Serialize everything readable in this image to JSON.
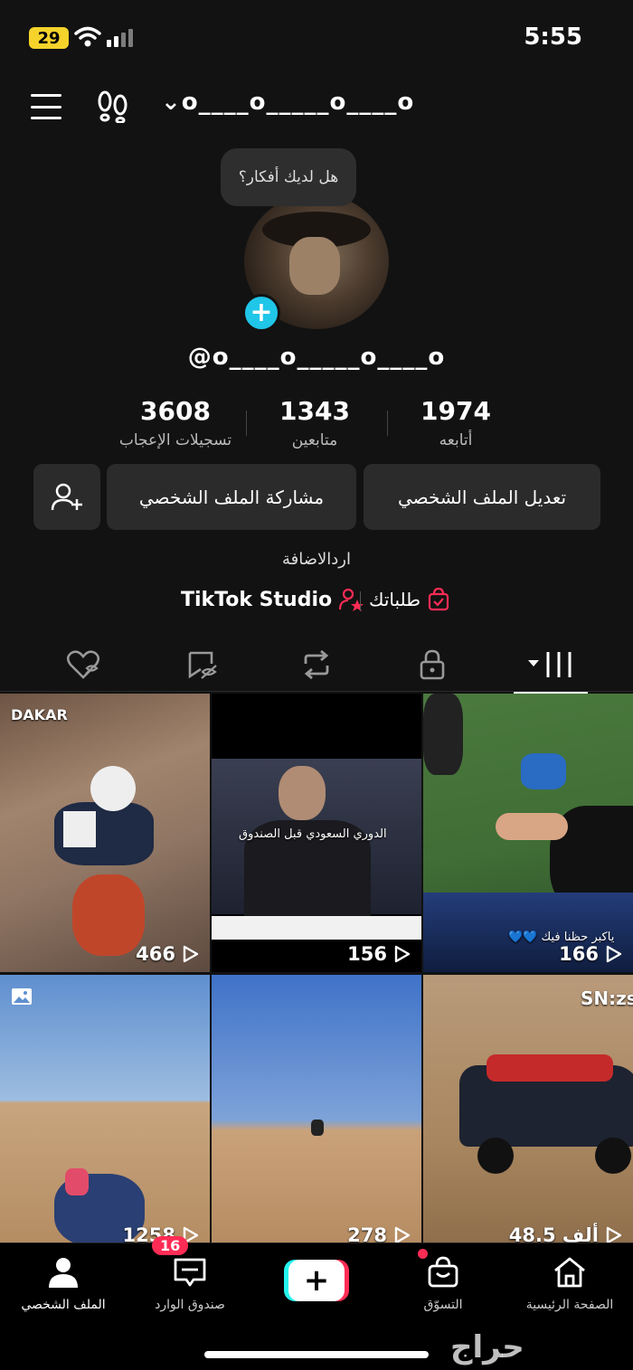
{
  "status_bar": {
    "battery": "29",
    "time": "5:55"
  },
  "header": {
    "username": "o____o_____o____o"
  },
  "profile": {
    "note_bubble": "هل لديك أفكار؟",
    "handle": "@o____o_____o____o",
    "stats": {
      "likes": {
        "value": "3608",
        "label": "تسجيلات الإعجاب"
      },
      "followers": {
        "value": "1343",
        "label": "متابعين"
      },
      "following": {
        "value": "1974",
        "label": "أتابعه"
      }
    },
    "buttons": {
      "edit": "تعديل الملف الشخصي",
      "share": "مشاركة الملف الشخصي"
    },
    "bio": "اردالاضافة",
    "links": {
      "studio": "TikTok Studio",
      "orders": "طلباتك"
    }
  },
  "grid": {
    "videos": [
      {
        "views": "466",
        "overlay": "DAKAR"
      },
      {
        "views": "156",
        "overlay": "الدوري السعودي قبل الصندوق"
      },
      {
        "views": "166",
        "overlay": "ياكبر حظنا فيك 💙💙"
      },
      {
        "views": "1258",
        "overlay": ""
      },
      {
        "views": "278",
        "overlay": ""
      },
      {
        "views": "48.5 ألف",
        "overlay": "SN:zs"
      }
    ]
  },
  "bottom_nav": {
    "home": "الصفحة الرئيسية",
    "shop": "التسوّق",
    "inbox": "صندوق الوارد",
    "inbox_badge": "16",
    "profile": "الملف الشخصي"
  },
  "watermark": "حراج"
}
